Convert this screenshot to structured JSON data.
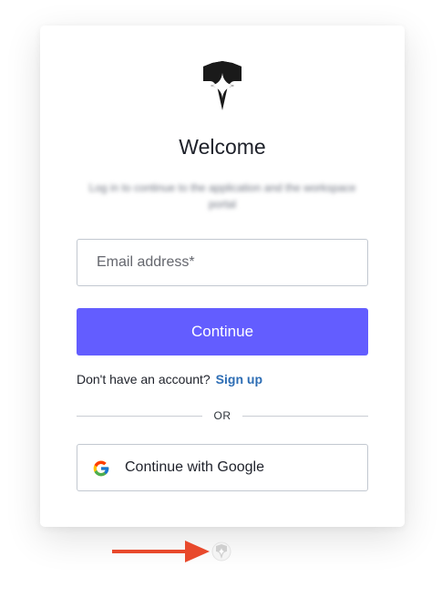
{
  "header": {
    "logo_icon": "shield-logo-icon",
    "title": "Welcome",
    "subtitle": "Log in to continue to the application and the workspace portal"
  },
  "form": {
    "email_placeholder": "Email address*",
    "continue_label": "Continue",
    "signup_prompt": "Don't have an account?",
    "signup_link": "Sign up",
    "divider_text": "OR",
    "google_label": "Continue with Google",
    "google_icon": "google-icon"
  },
  "annotation": {
    "arrow_icon": "red-arrow-icon",
    "badge_icon": "shield-badge-icon"
  },
  "colors": {
    "accent": "#635dff",
    "link": "#2d6db4",
    "annotation_arrow": "#e8492c"
  }
}
